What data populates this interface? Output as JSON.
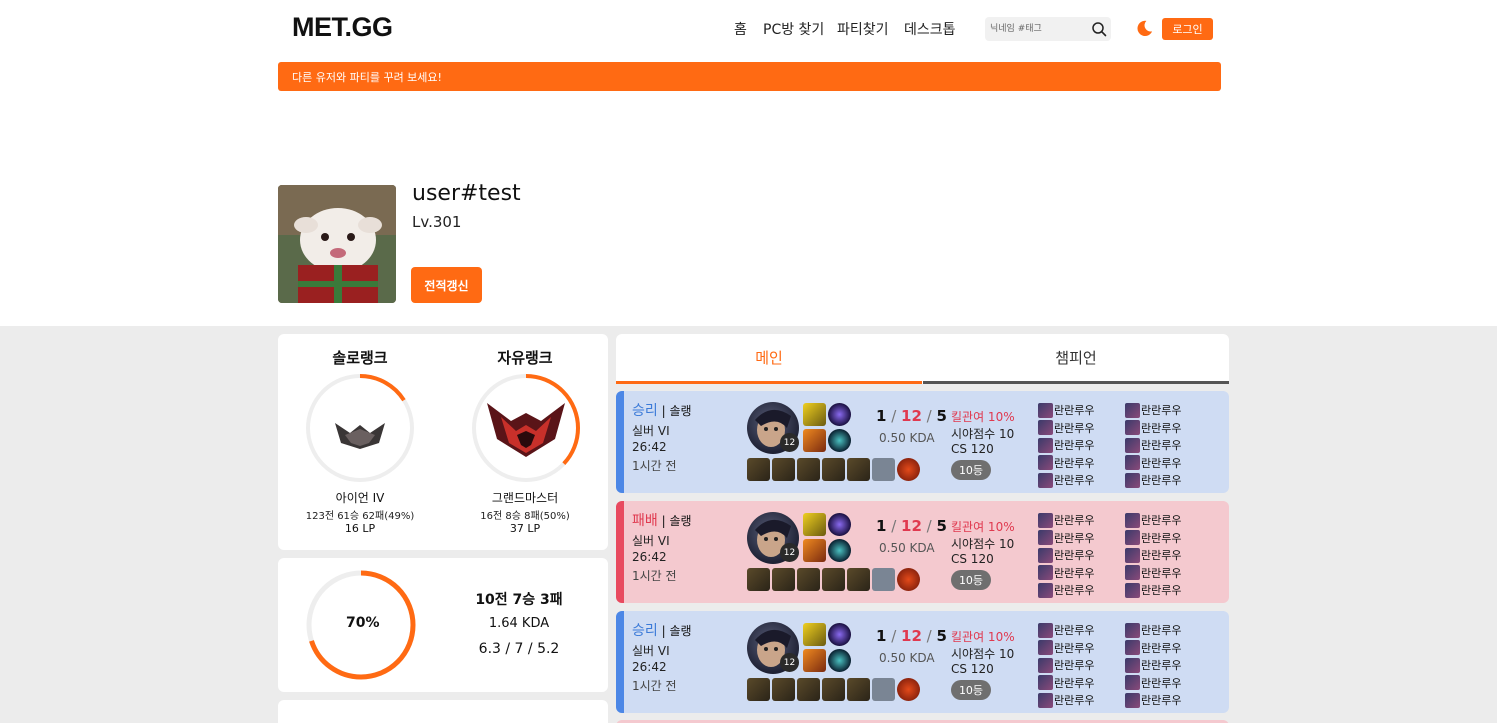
{
  "header": {
    "logo": "MET.GG",
    "nav": [
      "홈",
      "PC방 찾기",
      "파티찾기",
      "데스크톱"
    ],
    "search_placeholder": "닉네임 #태그",
    "login_label": "로그인"
  },
  "banner": {
    "text": "다른 유저와 파티를 꾸려 보세요!"
  },
  "profile": {
    "username": "user#test",
    "level": "Lv.301",
    "refresh_label": "전적갱신"
  },
  "ranks": [
    {
      "title": "솔로랭크",
      "tier": "아이언 IV",
      "record": "123전 61승 62패(49%)",
      "lp": "16 LP",
      "progress": 0.16
    },
    {
      "title": "자유랭크",
      "tier": "그랜드마스터",
      "record": "16전 8승 8패(50%)",
      "lp": "37 LP",
      "progress": 0.37
    }
  ],
  "summary": {
    "winrate_text": "70%",
    "winrate": 0.7,
    "record": "10전 7승 3패",
    "kda": "1.64 KDA",
    "avg": "6.3 / 7 / 5.2"
  },
  "tabs": [
    "메인",
    "챔피언"
  ],
  "matches": [
    {
      "result": "승리",
      "outcome": "win",
      "queue": "솔랭",
      "tier": "실버 VI",
      "duration": "26:42",
      "ago": "1시간 전",
      "champ_level": "12",
      "kills": "1",
      "deaths": "12",
      "assists": "5",
      "kda_ratio": "0.50 KDA",
      "kill_participation": "킬관여 10%",
      "vision": "시야점수 10",
      "cs": "CS 120",
      "placement": "10등",
      "players": [
        "란란루우",
        "란란루우",
        "란란루우",
        "란란루우",
        "란란루우",
        "란란루우",
        "란란루우",
        "란란루우",
        "란란루우",
        "란란루우"
      ]
    },
    {
      "result": "패배",
      "outcome": "loss",
      "queue": "솔랭",
      "tier": "실버 VI",
      "duration": "26:42",
      "ago": "1시간 전",
      "champ_level": "12",
      "kills": "1",
      "deaths": "12",
      "assists": "5",
      "kda_ratio": "0.50 KDA",
      "kill_participation": "킬관여 10%",
      "vision": "시야점수 10",
      "cs": "CS 120",
      "placement": "10등",
      "players": [
        "란란루우",
        "란란루우",
        "란란루우",
        "란란루우",
        "란란루우",
        "란란루우",
        "란란루우",
        "란란루우",
        "란란루우",
        "란란루우"
      ]
    },
    {
      "result": "승리",
      "outcome": "win",
      "queue": "솔랭",
      "tier": "실버 VI",
      "duration": "26:42",
      "ago": "1시간 전",
      "champ_level": "12",
      "kills": "1",
      "deaths": "12",
      "assists": "5",
      "kda_ratio": "0.50 KDA",
      "kill_participation": "킬관여 10%",
      "vision": "시야점수 10",
      "cs": "CS 120",
      "placement": "10등",
      "players": [
        "란란루우",
        "란란루우",
        "란란루우",
        "란란루우",
        "란란루우",
        "란란루우",
        "란란루우",
        "란란루우",
        "란란루우",
        "란란루우"
      ]
    }
  ],
  "colors": {
    "accent": "#ff6a13",
    "win": "#4c87e6",
    "loss": "#e84a5f"
  }
}
